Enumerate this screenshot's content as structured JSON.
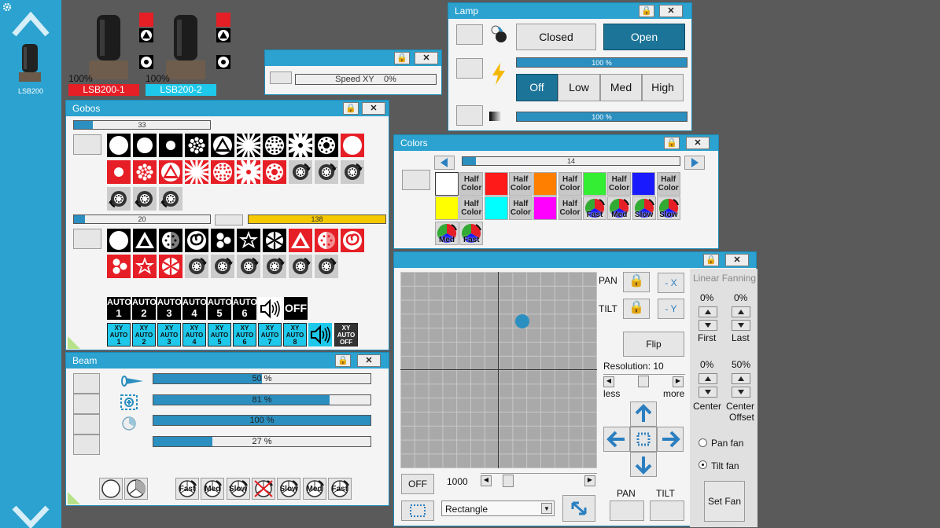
{
  "sidebar": {
    "device_label": "LSB200"
  },
  "fixtures": [
    {
      "percent": "100%",
      "name": "LSB200-1",
      "color": "#e61e26"
    },
    {
      "percent": "100%",
      "name": "LSB200-2",
      "color": "#1ec8ea"
    }
  ],
  "speed_window": {
    "bar_label": "Speed XY",
    "value": "0%"
  },
  "lamp": {
    "title": "Lamp",
    "closed_label": "Closed",
    "open_label": "Open",
    "bar1_label": "100 %",
    "bar1_value": 100,
    "modes": [
      "Off",
      "Low",
      "Med",
      "High"
    ],
    "bar2_label": "100 %",
    "bar2_value": 100
  },
  "gobos": {
    "title": "Gobos",
    "wheel1_value": "33",
    "wheel1_fill": 0.14,
    "wheel2_value": "20",
    "wheel2_fill": 0.08,
    "rotation_value": "138",
    "auto_labels": [
      [
        "AUTO",
        "1"
      ],
      [
        "AUTO",
        "2"
      ],
      [
        "AUTO",
        "3"
      ],
      [
        "AUTO",
        "4"
      ],
      [
        "AUTO",
        "5"
      ],
      [
        "AUTO",
        "6"
      ]
    ],
    "auto_off_label": "OFF",
    "xy_labels": [
      [
        "XY",
        "AUTO",
        "1"
      ],
      [
        "XY",
        "AUTO",
        "2"
      ],
      [
        "XY",
        "AUTO",
        "3"
      ],
      [
        "XY",
        "AUTO",
        "4"
      ],
      [
        "XY",
        "AUTO",
        "5"
      ],
      [
        "XY",
        "AUTO",
        "6"
      ],
      [
        "XY",
        "AUTO",
        "7"
      ],
      [
        "XY",
        "AUTO",
        "8"
      ]
    ],
    "xy_off_label": [
      "XY",
      "AUTO",
      "OFF"
    ]
  },
  "colors": {
    "title": "Colors",
    "wheel_value": "14",
    "wheel_fill": 0.06,
    "half_label": [
      "Half",
      "Color"
    ],
    "swatches_row1": [
      "#ffffff",
      "half",
      "#ff1a1a",
      "half",
      "#ff8000",
      "half",
      "#33ee33",
      "half",
      "#1a1aff",
      "half"
    ],
    "swatches_row2": [
      "#ffff00",
      "half",
      "#00ffff",
      "half",
      "#ff00ff",
      "half"
    ],
    "speed_labels": [
      "Fast",
      "Med",
      "Slow",
      "Slow"
    ],
    "speed_labels_row3": [
      "Med",
      "Fast"
    ]
  },
  "beam": {
    "title": "Beam",
    "bars": [
      {
        "label": "50 %",
        "value": 50
      },
      {
        "label": "81 %",
        "value": 81
      },
      {
        "label": "100 %",
        "value": 100
      },
      {
        "label": "27 %",
        "value": 27
      }
    ],
    "speed_labels": [
      "Fast",
      "Med",
      "Slow",
      "",
      "Slow",
      "Med",
      "Fast"
    ]
  },
  "position": {
    "pan_label": "PAN",
    "tilt_label": "TILT",
    "neg_x_label": "- X",
    "neg_y_label": "- Y",
    "flip_label": "Flip",
    "resolution_label": "Resolution: 10",
    "less_label": "less",
    "more_label": "more",
    "off_label": "OFF",
    "speed_value": "1000",
    "shape_value": "Rectangle",
    "pan_bottom_label": "PAN",
    "tilt_bottom_label": "TILT",
    "dot_x": 0.12,
    "dot_y": 0.25
  },
  "fanning": {
    "title": "Linear Fanning",
    "first_value": "0%",
    "last_value": "0%",
    "first_label": "First",
    "last_label": "Last",
    "center_value": "0%",
    "offset_value": "50%",
    "center_label": "Center",
    "offset_label_1": "Center",
    "offset_label_2": "Offset",
    "pan_fan_label": "Pan fan",
    "tilt_fan_label": "Tilt fan",
    "set_fan_label": "Set Fan"
  }
}
